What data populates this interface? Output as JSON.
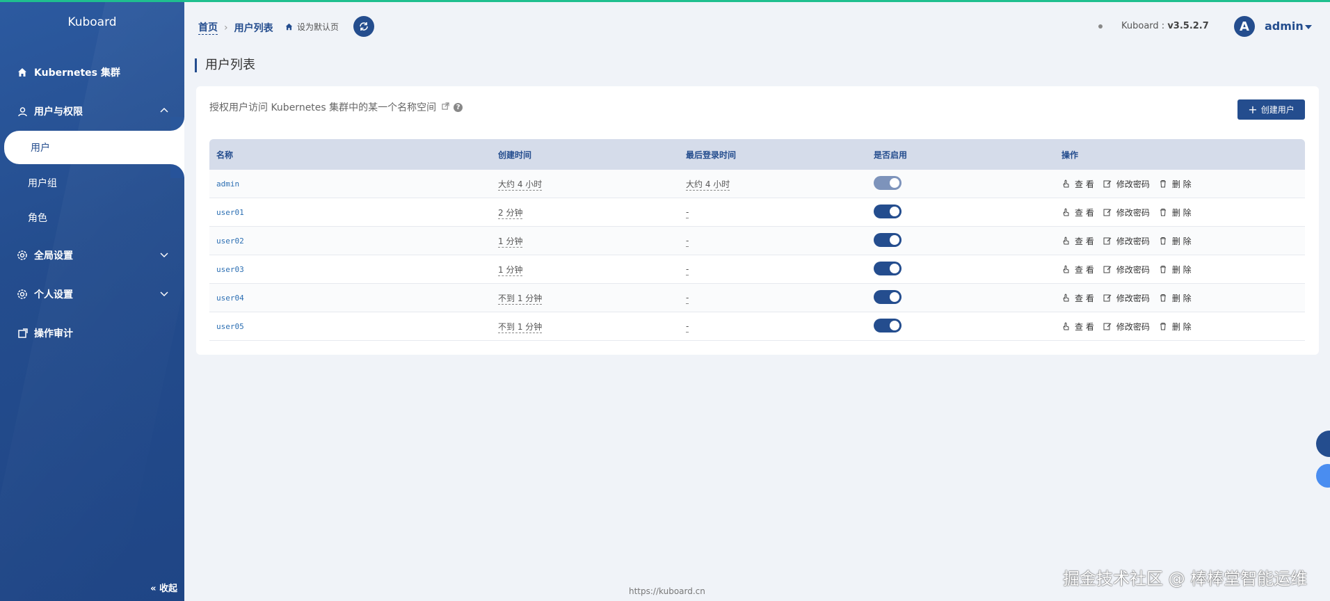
{
  "sidebar": {
    "logo": "Kuboard",
    "items": [
      {
        "label": "Kubernetes 集群"
      },
      {
        "label": "用户与权限"
      },
      {
        "label": "全局设置"
      },
      {
        "label": "个人设置"
      },
      {
        "label": "操作审计"
      }
    ],
    "sub_items": [
      {
        "label": "用户"
      },
      {
        "label": "用户组"
      },
      {
        "label": "角色"
      }
    ],
    "collapse_label": "« 收起"
  },
  "header": {
    "breadcrumb_home": "首页",
    "breadcrumb_current": "用户列表",
    "set_default": "设为默认页",
    "version_label": "Kuboard :",
    "version": "v3.5.2.7",
    "avatar_letter": "A",
    "user": "admin"
  },
  "page": {
    "title": "用户列表",
    "description": "授权用户访问 Kubernetes 集群中的某一个名称空间",
    "help": "?",
    "create_button": "创建用户"
  },
  "table": {
    "columns": [
      "名称",
      "创建时间",
      "最后登录时间",
      "是否启用",
      "操作"
    ],
    "rows": [
      {
        "name": "admin",
        "created": "大约 4 小时",
        "last_login": "大约 4 小时",
        "enabled": true
      },
      {
        "name": "user01",
        "created": "2 分钟",
        "last_login": "-",
        "enabled": true
      },
      {
        "name": "user02",
        "created": "1 分钟",
        "last_login": "-",
        "enabled": true
      },
      {
        "name": "user03",
        "created": "1 分钟",
        "last_login": "-",
        "enabled": true
      },
      {
        "name": "user04",
        "created": "不到 1 分钟",
        "last_login": "-",
        "enabled": true
      },
      {
        "name": "user05",
        "created": "不到 1 分钟",
        "last_login": "-",
        "enabled": true
      }
    ],
    "actions": {
      "view": "查 看",
      "change_password": "修改密码",
      "delete": "删 除"
    }
  },
  "footer": {
    "url": "https://kuboard.cn",
    "watermark": "掘金技术社区 @ 棒棒堂智能运维"
  },
  "colors": {
    "primary": "#244d8e",
    "accent": "#1fbf8f",
    "link": "#2c6fb3"
  }
}
